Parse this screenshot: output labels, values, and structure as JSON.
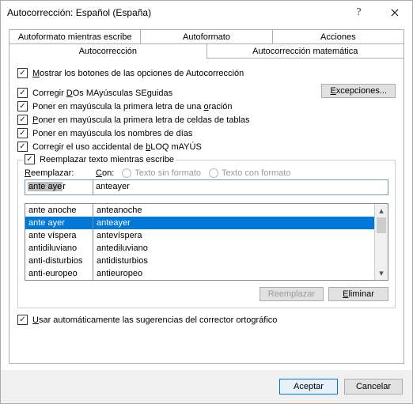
{
  "window": {
    "title": "Autocorrección: Español (España)"
  },
  "tabs": {
    "row1": [
      "Autoformato mientras escribe",
      "Autoformato",
      "Acciones"
    ],
    "row2": [
      "Autocorrección",
      "Autocorrección matemática"
    ],
    "active": "Autocorrección"
  },
  "checks": {
    "showButtons": "Mostrar los botones de las opciones de Autocorrección",
    "twoCaps_pre": "Corregir ",
    "twoCaps_u": "D",
    "twoCaps_post": "Os MAyúsculas SEguidas",
    "firstSentence": "Poner en mayúscula la primera letra de una ",
    "firstSentence_u": "o",
    "firstSentence_post": "ración",
    "firstCell_u": "P",
    "firstCell_post": "oner en mayúscula la primera letra de celdas de tablas",
    "daysCaps": "Poner en mayúscula los nombres de días",
    "capsLock": "Corregir el uso accidental de ",
    "capsLock_u": "b",
    "capsLock_post": "LOQ mAYÚS"
  },
  "exceptions": "Excepciones...",
  "replaceSection": {
    "legend": "Reemplazar texto mientras escribe",
    "reemplazar_u": "R",
    "reemplazar_post": "eemplazar:",
    "con_u": "C",
    "con_post": "on:",
    "radio1": "Texto sin formato",
    "radio2": "Texto con formato",
    "input_reemplazar_sel": "ante aye",
    "input_reemplazar_rest": "r",
    "input_con": "anteayer"
  },
  "list": [
    {
      "a": "ante anoche",
      "b": "anteanoche"
    },
    {
      "a": "ante ayer",
      "b": "anteayer",
      "selected": true
    },
    {
      "a": "ante víspera",
      "b": "antevíspera"
    },
    {
      "a": "antidiluviano",
      "b": "antediluviano"
    },
    {
      "a": "anti-disturbios",
      "b": "antidisturbios"
    },
    {
      "a": "anti-europeo",
      "b": "antieuropeo"
    }
  ],
  "buttons": {
    "reemplazar": "Reemplazar",
    "eliminar_u": "E",
    "eliminar_post": "liminar"
  },
  "autoSuggest_u": "U",
  "autoSuggest_post": "sar automáticamente las sugerencias del corrector ortográfico",
  "footer": {
    "ok": "Aceptar",
    "cancel": "Cancelar"
  }
}
